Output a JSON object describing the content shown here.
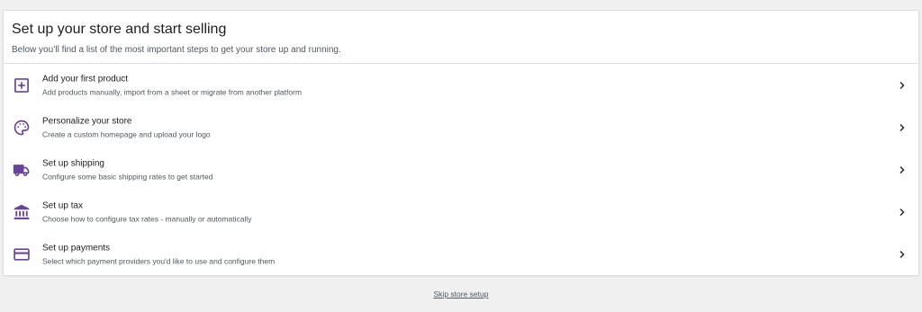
{
  "header": {
    "title": "Set up your store and start selling",
    "subtitle": "Below you’ll find a list of the most important steps to get your store up and running."
  },
  "tasks": [
    {
      "title": "Add your first product",
      "description": "Add products manually, import from a sheet or migrate from another platform",
      "icon": "add-box-icon"
    },
    {
      "title": "Personalize your store",
      "description": "Create a custom homepage and upload your logo",
      "icon": "palette-icon"
    },
    {
      "title": "Set up shipping",
      "description": "Configure some basic shipping rates to get started",
      "icon": "truck-icon"
    },
    {
      "title": "Set up tax",
      "description": "Choose how to configure tax rates - manually or automatically",
      "icon": "bank-icon"
    },
    {
      "title": "Set up payments",
      "description": "Select which payment providers you'd like to use and configure them",
      "icon": "credit-card-icon"
    }
  ],
  "footer": {
    "skip_label": "Skip store setup"
  },
  "colors": {
    "icon": "#674399",
    "background": "#f0f0f1",
    "card": "#ffffff"
  }
}
